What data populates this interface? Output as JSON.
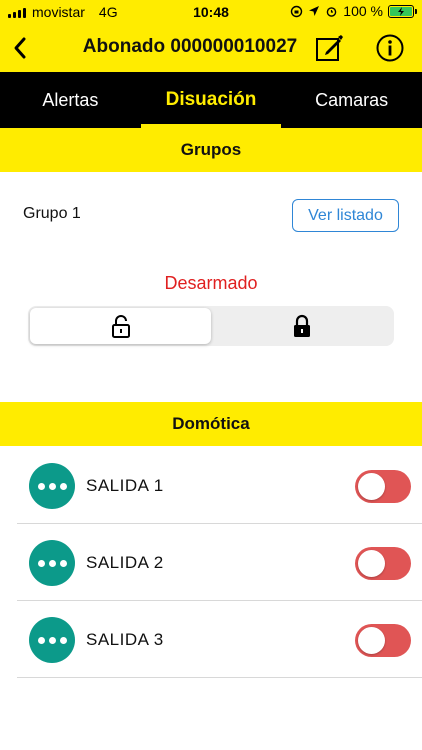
{
  "status_bar": {
    "carrier": "movistar",
    "network": "4G",
    "time": "10:48",
    "battery": "100 %"
  },
  "header": {
    "title": "Abonado 000000010027",
    "back_icon": "chevron-left-icon",
    "edit_icon": "edit-icon",
    "info_icon": "info-icon"
  },
  "tabs": [
    {
      "label": "Alertas",
      "active": false
    },
    {
      "label": "Disuación",
      "active": true
    },
    {
      "label": "Camaras",
      "active": false
    }
  ],
  "groups": {
    "title": "Grupos",
    "group_name": "Grupo 1",
    "list_button": "Ver listado",
    "status": "Desarmado",
    "status_color": "#e02020",
    "options": [
      "unlock-icon",
      "lock-icon"
    ],
    "selected_option": 0
  },
  "domotica": {
    "title": "Domótica",
    "items": [
      {
        "label": "SALIDA 1",
        "on": false
      },
      {
        "label": "SALIDA 2",
        "on": false
      },
      {
        "label": "SALIDA 3",
        "on": false
      }
    ]
  },
  "colors": {
    "accent_yellow": "#ffec00",
    "tab_bar": "#000000",
    "teal": "#0c9a8a",
    "toggle_off": "#e05555",
    "link_blue": "#2f86d6"
  }
}
